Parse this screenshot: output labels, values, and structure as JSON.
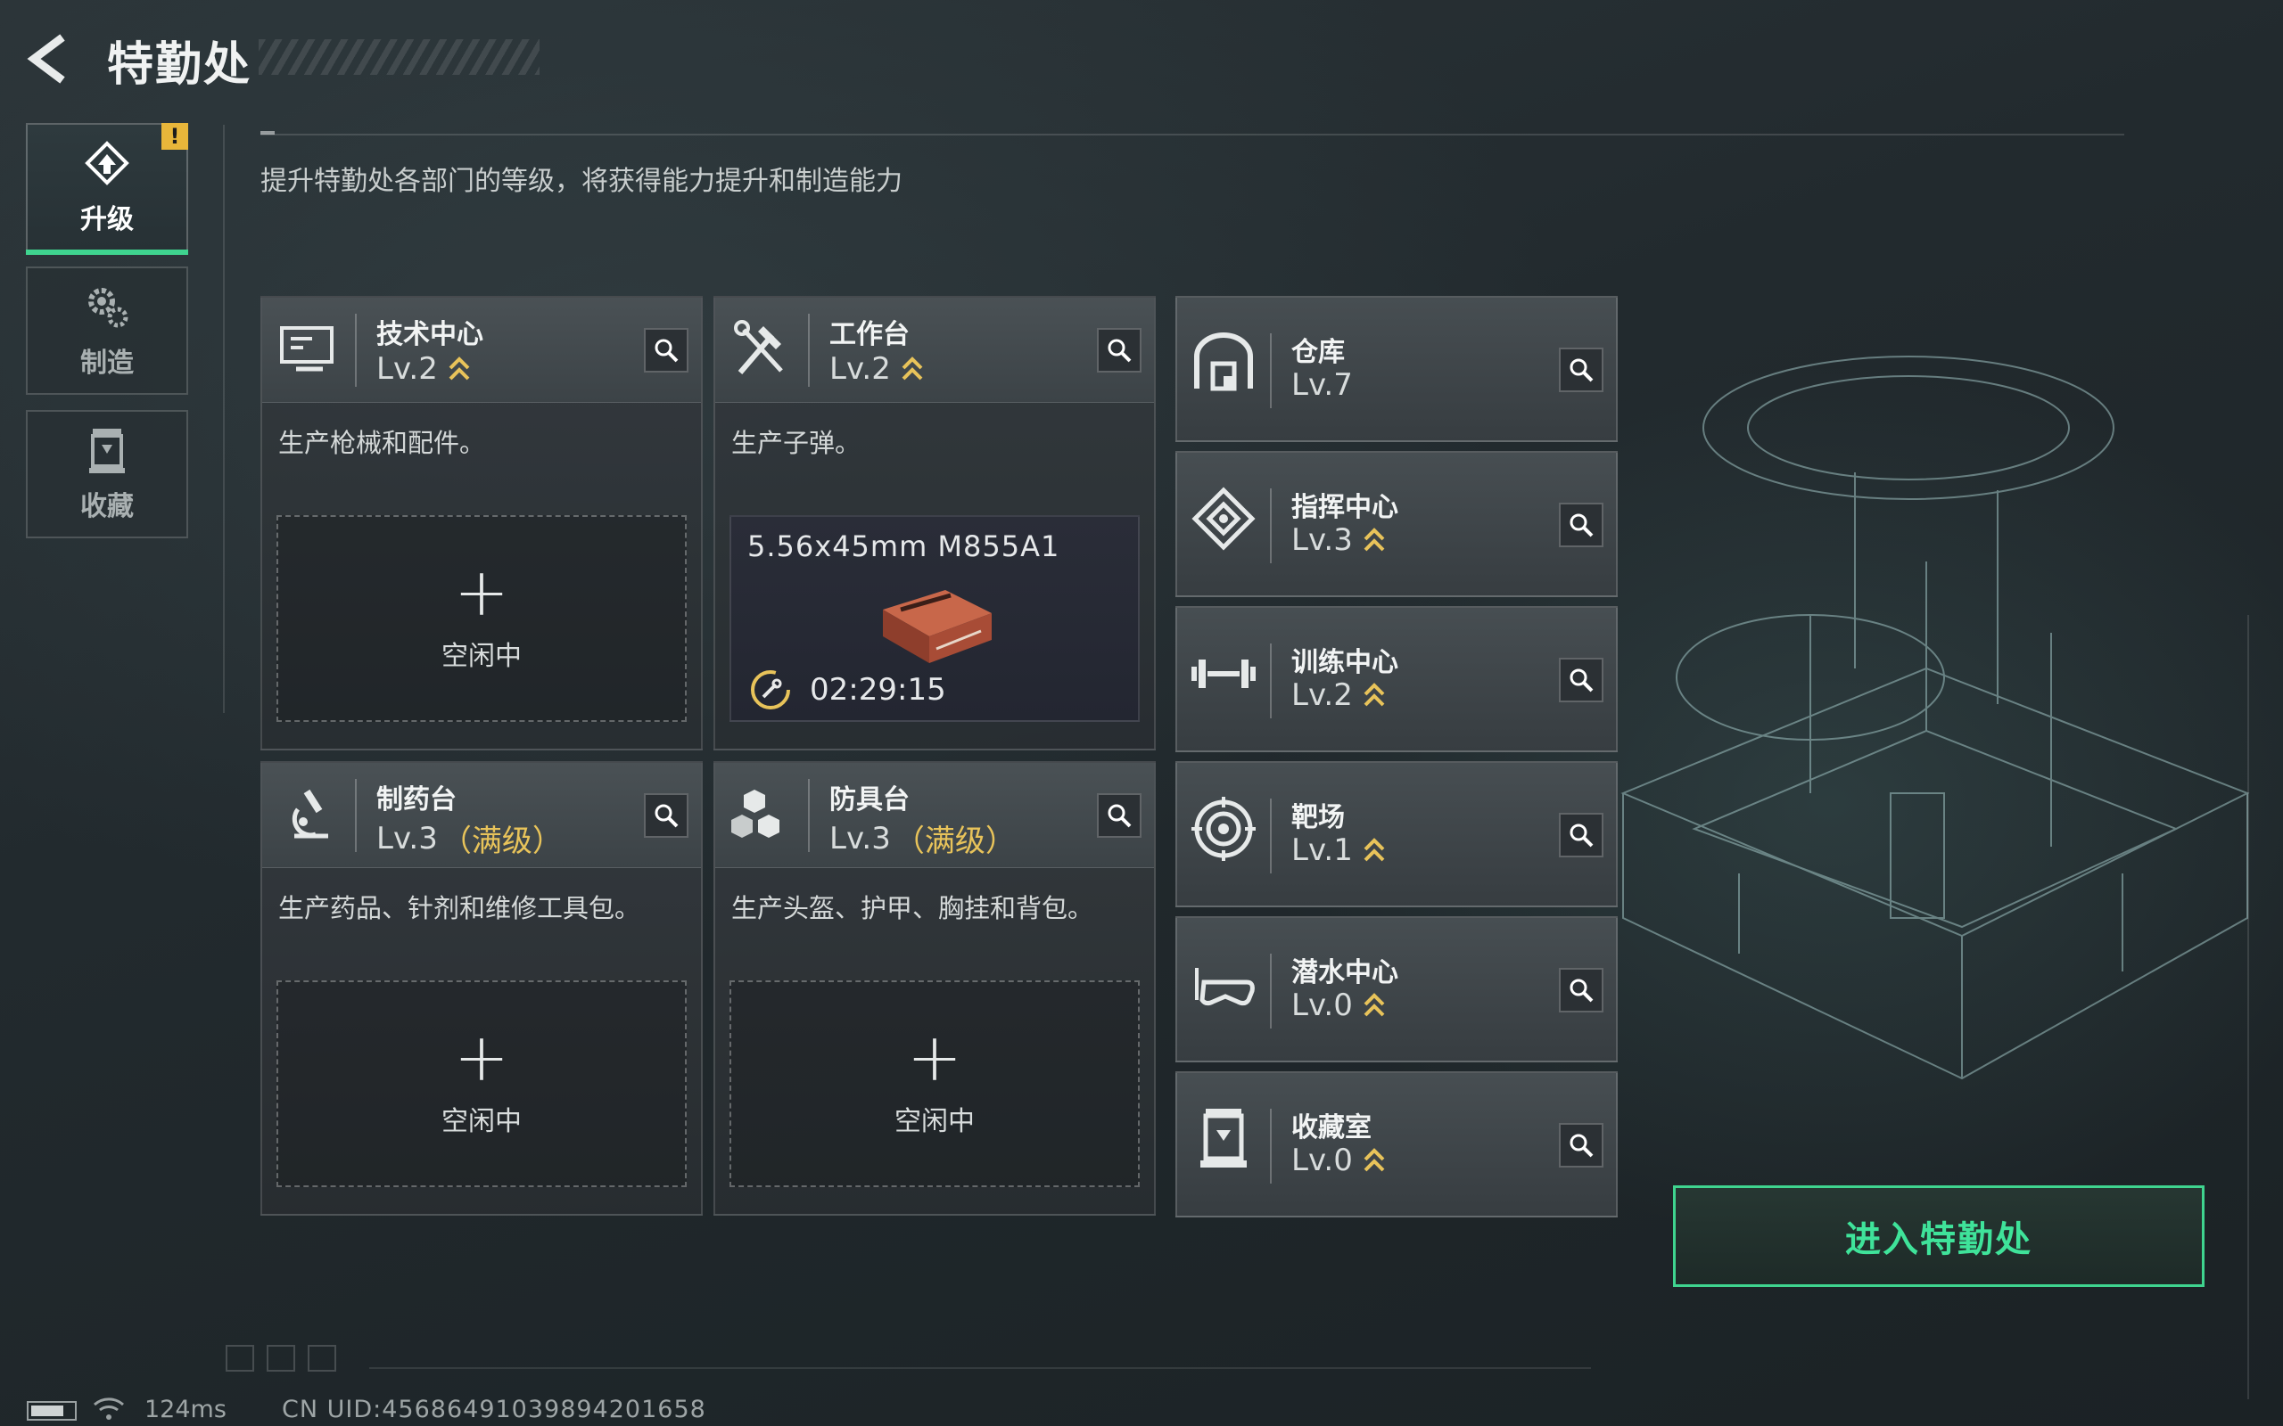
{
  "header": {
    "title": "特勤处",
    "subtitle": "提升特勤处各部门的等级，将获得能力提升和制造能力"
  },
  "nav": [
    {
      "label": "升级",
      "icon": "upgrade-icon",
      "active": true,
      "badge": "!"
    },
    {
      "label": "制造",
      "icon": "gears-icon",
      "active": false
    },
    {
      "label": "收藏",
      "icon": "collection-icon",
      "active": false
    }
  ],
  "departments": [
    {
      "name": "技术中心",
      "level": "Lv.2",
      "icon": "monitor-icon",
      "desc": "生产枪械和配件。",
      "slot_status": "空闲中"
    },
    {
      "name": "工作台",
      "level": "Lv.2",
      "icon": "hammer-wrench-icon",
      "desc": "生产子弹。",
      "crafting": {
        "item": "5.56x45mm M855A1",
        "timer": "02:29:15"
      }
    },
    {
      "name": "制药台",
      "level": "Lv.3",
      "maxed": "（满级）",
      "icon": "microscope-icon",
      "desc": "生产药品、针剂和维修工具包。",
      "slot_status": "空闲中"
    },
    {
      "name": "防具台",
      "level": "Lv.3",
      "maxed": "（满级）",
      "icon": "cubes-icon",
      "desc": "生产头盔、护甲、胸挂和背包。",
      "slot_status": "空闲中"
    }
  ],
  "facilities": [
    {
      "name": "仓库",
      "level": "Lv.7",
      "icon": "warehouse-icon"
    },
    {
      "name": "指挥中心",
      "level": "Lv.3",
      "icon": "command-icon"
    },
    {
      "name": "训练中心",
      "level": "Lv.2",
      "icon": "dumbbell-icon"
    },
    {
      "name": "靶场",
      "level": "Lv.1",
      "icon": "target-icon"
    },
    {
      "name": "潜水中心",
      "level": "Lv.0",
      "icon": "diving-mask-icon"
    },
    {
      "name": "收藏室",
      "level": "Lv.0",
      "icon": "collection-room-icon"
    }
  ],
  "enter_button": {
    "label": "进入特勤处"
  },
  "footer": {
    "ping": "124ms",
    "uid": "CN UID:456864910398942016​58"
  },
  "colors": {
    "accent": "#3fd48f",
    "level_up": "#e8c35a",
    "badge": "#e8b63a"
  }
}
